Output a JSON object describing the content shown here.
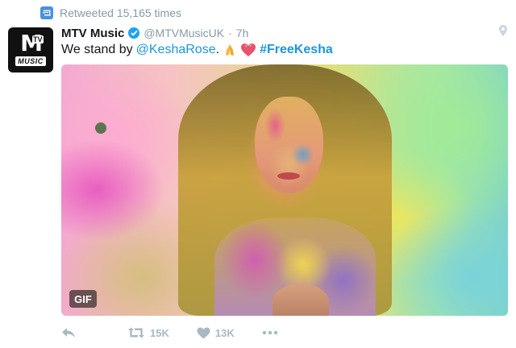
{
  "retweet_context": {
    "text": "Retweeted 15,165 times",
    "icon": "retweet-badge-icon"
  },
  "tweet": {
    "display_name": "MTV Music",
    "handle": "@MTVMusicUK",
    "separator": "·",
    "time": "7h",
    "avatar": {
      "logo_m": "M",
      "logo_tv": "TV",
      "logo_music": "MUSIC"
    },
    "text_prefix": "We stand by",
    "mention": "@KeshaRose",
    "text_suffix": ".",
    "emojis": [
      "folded-hands-emoji",
      "heart-emoji"
    ],
    "hashtag": "#FreeKesha"
  },
  "media": {
    "badge": "GIF"
  },
  "actions": {
    "retweets": "15K",
    "likes": "13K"
  },
  "colors": {
    "link": "#1b95e0",
    "verified": "#1da1f2",
    "muted": "#8899a6",
    "action": "#aab8c2"
  }
}
